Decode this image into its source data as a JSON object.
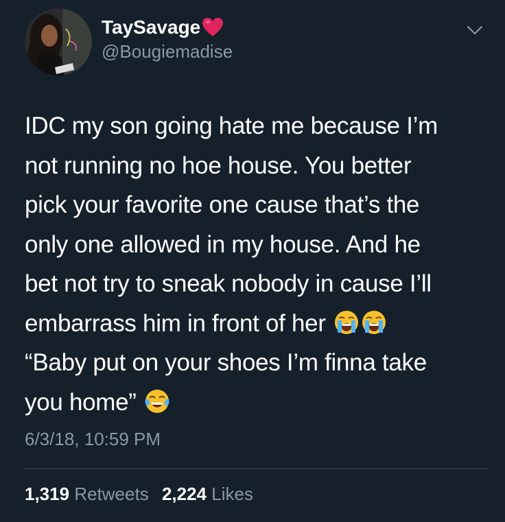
{
  "user": {
    "display_name": "TaySavage",
    "handle": "@Bougiemadise"
  },
  "icons": {
    "verified_heart": "red-heart-emoji",
    "menu": "chevron-down-icon",
    "crying_face": "loudly-crying-face-emoji",
    "laughing_face": "face-with-tears-of-joy-emoji"
  },
  "tweet": {
    "lines": [
      "IDC my son going hate me because I’m",
      "not running no hoe house. You better",
      "pick your favorite one cause that’s the",
      "only one allowed in my house. And he",
      "bet not try to sneak nobody in cause I’ll",
      "embarrass him in front of her",
      "“Baby put on your shoes I’m finna take",
      "you home”"
    ],
    "timestamp": "6/3/18, 10:59 PM"
  },
  "stats": {
    "retweets_count": "1,319",
    "retweets_label": "Retweets",
    "likes_count": "2,224",
    "likes_label": "Likes"
  },
  "colors": {
    "background": "#15202b",
    "text_primary": "#ffffff",
    "text_secondary": "#8899a6",
    "divider": "#38444d",
    "heart": "#e0245e"
  }
}
